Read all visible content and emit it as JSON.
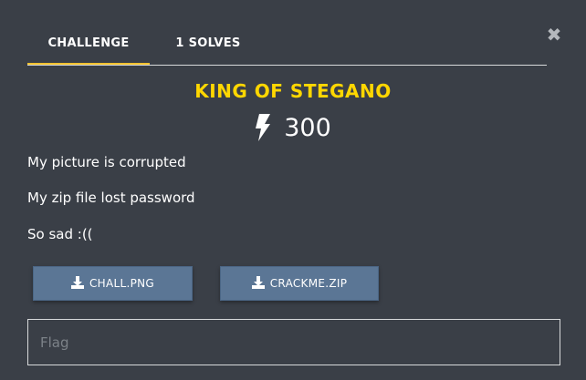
{
  "modal": {
    "close_glyph": "✖",
    "tabs": [
      {
        "label": "CHALLENGE",
        "active": true
      },
      {
        "label": "1 SOLVES",
        "active": false
      }
    ]
  },
  "challenge": {
    "title": "KING OF STEGANO",
    "points": "300",
    "points_icon": "bolt-icon",
    "description": [
      "My picture is corrupted",
      "My zip file lost password",
      "So sad :(("
    ]
  },
  "files": [
    {
      "label": "CHALL.PNG",
      "icon": "download-icon"
    },
    {
      "label": "CRACKME.ZIP",
      "icon": "download-icon"
    }
  ],
  "flag": {
    "placeholder": "Flag",
    "value": ""
  },
  "colors": {
    "background": "#3a3f47",
    "title": "#ffd700",
    "tab_underline": "#f2c230",
    "file_button": "#5b7695"
  }
}
